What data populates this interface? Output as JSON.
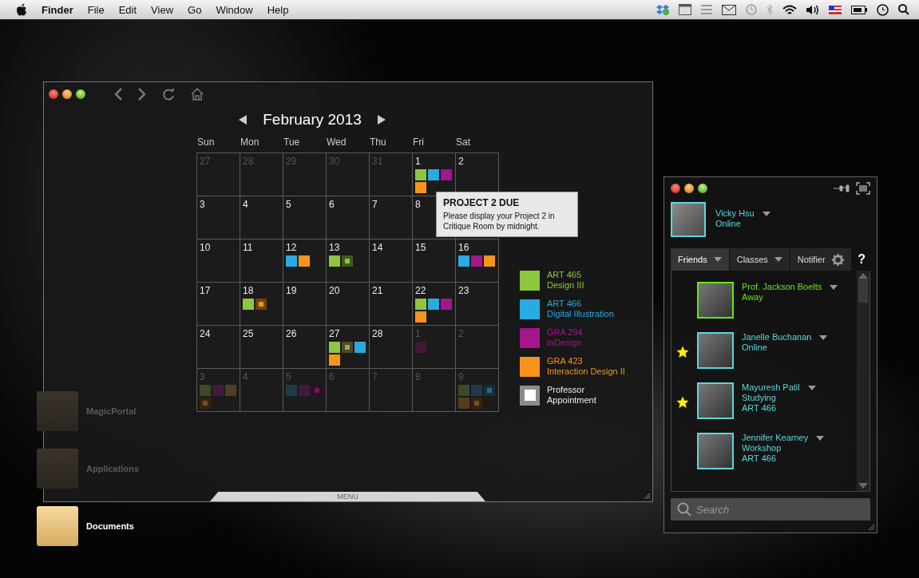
{
  "menu_bar": {
    "app": "Finder",
    "menus": [
      "File",
      "Edit",
      "View",
      "Go",
      "Window",
      "Help"
    ]
  },
  "desktop_icons": [
    {
      "label": "MagicPortal",
      "dimmed": true
    },
    {
      "label": "Applications",
      "dimmed": true
    },
    {
      "label": "Documents",
      "dimmed": false
    }
  ],
  "calendar": {
    "month": "February 2013",
    "weekdays": [
      "Sun",
      "Mon",
      "Tue",
      "Wed",
      "Thu",
      "Fri",
      "Sat"
    ],
    "weeks": [
      [
        {
          "day": "27",
          "other_month": true
        },
        {
          "day": "28",
          "other_month": true
        },
        {
          "day": "29",
          "other_month": true
        },
        {
          "day": "30",
          "other_month": true
        },
        {
          "day": "31",
          "other_month": true
        },
        {
          "day": "1",
          "other_month": false,
          "events": [
            {
              "kind": "course",
              "color": "#8dc63f"
            },
            {
              "kind": "course",
              "color": "#29abe2"
            },
            {
              "kind": "course",
              "color": "#a3168c"
            },
            {
              "kind": "course",
              "color": "#f7941d"
            }
          ]
        },
        {
          "day": "2",
          "other_month": false
        }
      ],
      [
        {
          "day": "3",
          "other_month": false
        },
        {
          "day": "4",
          "other_month": false
        },
        {
          "day": "5",
          "other_month": false
        },
        {
          "day": "6",
          "other_month": false
        },
        {
          "day": "7",
          "other_month": false
        },
        {
          "day": "8",
          "other_month": false
        }
      ],
      [
        {
          "day": "10",
          "other_month": false
        },
        {
          "day": "11",
          "other_month": false
        },
        {
          "day": "12",
          "other_month": false,
          "events": [
            {
              "kind": "course",
              "color": "#29abe2"
            },
            {
              "kind": "course",
              "color": "#f7941d"
            }
          ]
        },
        {
          "day": "13",
          "other_month": false,
          "events": [
            {
              "kind": "course",
              "color": "#8dc63f"
            },
            {
              "kind": "appointment",
              "color": "#8dc63f"
            }
          ]
        },
        {
          "day": "14",
          "other_month": false
        },
        {
          "day": "15",
          "other_month": false
        },
        {
          "day": "16",
          "other_month": false,
          "events": [
            {
              "kind": "course",
              "color": "#29abe2"
            },
            {
              "kind": "course",
              "color": "#a3168c"
            },
            {
              "kind": "course",
              "color": "#f7941d"
            }
          ]
        }
      ],
      [
        {
          "day": "17",
          "other_month": false
        },
        {
          "day": "18",
          "other_month": false,
          "events": [
            {
              "kind": "course",
              "color": "#8dc63f"
            },
            {
              "kind": "appointment",
              "color": "#f7941d"
            }
          ]
        },
        {
          "day": "19",
          "other_month": false
        },
        {
          "day": "20",
          "other_month": false
        },
        {
          "day": "21",
          "other_month": false
        },
        {
          "day": "22",
          "other_month": false,
          "events": [
            {
              "kind": "course",
              "color": "#8dc63f"
            },
            {
              "kind": "course",
              "color": "#29abe2"
            },
            {
              "kind": "course",
              "color": "#a3168c"
            },
            {
              "kind": "course",
              "color": "#f7941d"
            }
          ]
        },
        {
          "day": "23",
          "other_month": false
        }
      ],
      [
        {
          "day": "24",
          "other_month": false
        },
        {
          "day": "25",
          "other_month": false
        },
        {
          "day": "26",
          "other_month": false
        },
        {
          "day": "27",
          "other_month": false,
          "events": [
            {
              "kind": "course",
              "color": "#8dc63f"
            },
            {
              "kind": "appointment",
              "color": "#a9a45a"
            },
            {
              "kind": "course",
              "color": "#29abe2"
            },
            {
              "kind": "course",
              "color": "#f7941d"
            }
          ]
        },
        {
          "day": "28",
          "other_month": false
        },
        {
          "day": "1",
          "other_month": true,
          "events": [
            {
              "kind": "course",
              "color": "#3e1a38"
            }
          ]
        },
        {
          "day": "2",
          "other_month": true
        }
      ],
      [
        {
          "day": "3",
          "other_month": true,
          "events": [
            {
              "kind": "course",
              "color": "#3c4a28"
            },
            {
              "kind": "course",
              "color": "#3e1c3a"
            },
            {
              "kind": "course",
              "color": "#533e20"
            },
            {
              "kind": "appointment",
              "color": "#7a4f1a"
            }
          ]
        },
        {
          "day": "4",
          "other_month": true
        },
        {
          "day": "5",
          "other_month": true,
          "events": [
            {
              "kind": "course",
              "color": "#1f3a4a"
            },
            {
              "kind": "course",
              "color": "#3e1c3a"
            },
            {
              "kind": "appointment",
              "color": "#6a1a5a"
            }
          ]
        },
        {
          "day": "6",
          "other_month": true
        },
        {
          "day": "7",
          "other_month": true
        },
        {
          "day": "8",
          "other_month": true
        },
        {
          "day": "9",
          "other_month": true,
          "events": [
            {
              "kind": "course",
              "color": "#3c4a28"
            },
            {
              "kind": "course",
              "color": "#1f3a4a"
            },
            {
              "kind": "appointment",
              "color": "#2a6a8a"
            },
            {
              "kind": "course",
              "color": "#533e20"
            },
            {
              "kind": "appointment",
              "color": "#7a4f1a"
            }
          ]
        }
      ]
    ]
  },
  "tooltip": {
    "title": "PROJECT 2 DUE",
    "text": "Please display your Project 2 in Critique Room by midnight."
  },
  "legend": [
    {
      "kind": "course",
      "code": "ART 465",
      "name": "Design III",
      "color": "#8dc63f"
    },
    {
      "kind": "course",
      "code": "ART 466",
      "name": "Digital Illustration",
      "color": "#29abe2"
    },
    {
      "kind": "course",
      "code": "GRA 294",
      "name": "InDesign",
      "color": "#a3168c"
    },
    {
      "kind": "course",
      "code": "GRA 423",
      "name": "Interaction Design II",
      "color": "#f7941d"
    },
    {
      "kind": "appointment",
      "code": "Professor",
      "name": "Appointment",
      "color": "#8c8c8c"
    }
  ],
  "menu_tab": "MENU",
  "friends_panel": {
    "user": {
      "name": "Vicky Hsu",
      "status": "Online"
    },
    "tabs": [
      {
        "label": "Friends",
        "selected": true
      },
      {
        "label": "Classes",
        "selected": false
      },
      {
        "label": "Notifier",
        "selected": false
      }
    ],
    "help": "?",
    "friends": [
      {
        "name": "Prof. Jackson Boelts",
        "status": "Away",
        "starred": false,
        "color": "#66e61a"
      },
      {
        "name": "Janelle Buchanan",
        "status": "Online",
        "starred": true,
        "color": "#5ad8dc"
      },
      {
        "name": "Mayuresh Patil",
        "status": "Studying",
        "detail": "ART 466",
        "starred": true,
        "color": "#5ad8dc"
      },
      {
        "name": "Jennifer Kearney",
        "status": "Workshop",
        "detail": "ART 466",
        "starred": false,
        "color": "#5ad8dc"
      }
    ],
    "search": {
      "placeholder": "Search"
    }
  }
}
